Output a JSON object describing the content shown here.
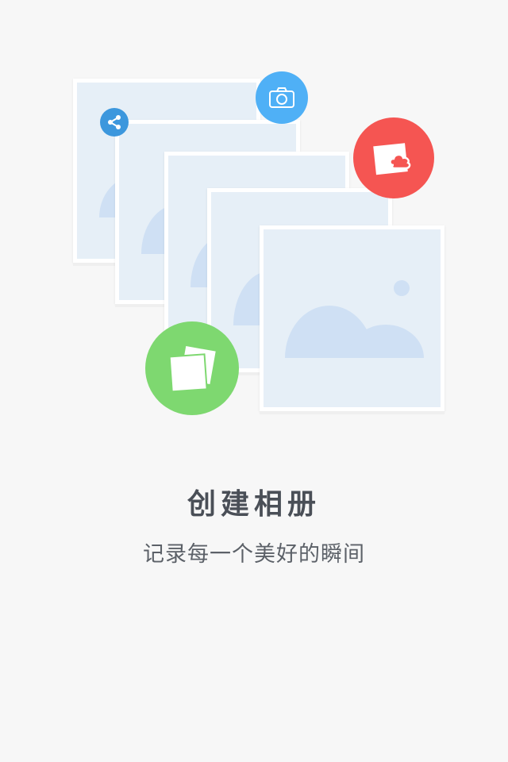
{
  "screen": {
    "title": "创建相册",
    "subtitle": "记录每一个美好的瞬间"
  },
  "illustration": {
    "photo_cards": [
      {
        "label": "album-photo-1"
      },
      {
        "label": "album-photo-2"
      },
      {
        "label": "album-photo-3"
      },
      {
        "label": "album-photo-4"
      },
      {
        "label": "album-photo-5"
      }
    ],
    "badges": [
      {
        "icon": "camera-icon",
        "color": "#4fb0f6"
      },
      {
        "icon": "share-icon",
        "color": "#3c97dd"
      },
      {
        "icon": "cloud-photo-icon",
        "color": "#f55552"
      },
      {
        "icon": "photos-stack-icon",
        "color": "#7ed870"
      }
    ],
    "colors": {
      "background": "#f7f7f7",
      "card_fill": "#e6eff7",
      "card_border": "#ffffff",
      "landscape": "#cfe0f4",
      "text_title": "#4a4f57",
      "text_subtitle": "#5c6168"
    }
  }
}
